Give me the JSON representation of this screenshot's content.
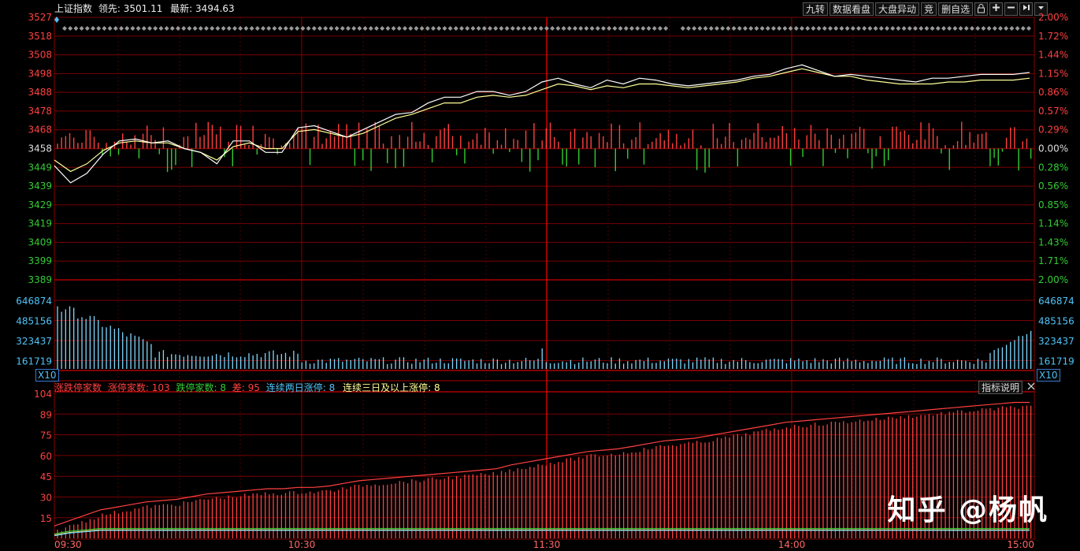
{
  "header": {
    "index_name": "上证指数",
    "leading_label": "领先:",
    "leading_value": "3501.11",
    "latest_label": "最新:",
    "latest_value": "3494.63"
  },
  "toolbar": {
    "items": [
      "九转",
      "数据看盘",
      "大盘异动",
      "竞",
      "删自选"
    ],
    "icons": [
      "lock-icon",
      "plus-icon",
      "minus-icon",
      "skip-right-icon",
      "dropdown-icon"
    ]
  },
  "price_axis": {
    "left_ticks": [
      "3527",
      "3518",
      "3508",
      "3498",
      "3488",
      "3478",
      "3468",
      "3458",
      "3449",
      "3439",
      "3429",
      "3419",
      "3409",
      "3399",
      "3389"
    ],
    "right_ticks_up": [
      "2.00%",
      "1.72%",
      "1.44%",
      "1.15%",
      "0.86%",
      "0.57%",
      "0.29%"
    ],
    "right_zero": "0.00%",
    "right_ticks_down": [
      "0.28%",
      "0.56%",
      "0.85%",
      "1.14%",
      "1.43%",
      "1.71%",
      "2.00%"
    ]
  },
  "volume_axis": {
    "ticks": [
      "646874",
      "485156",
      "323437",
      "161719"
    ],
    "multiplier": "X10"
  },
  "indicator": {
    "name": "涨跌停家数",
    "up_limit_label": "涨停家数:",
    "up_limit_value": "103",
    "down_limit_label": "跌停家数:",
    "down_limit_value": "8",
    "diff_label": "差:",
    "diff_value": "95",
    "two_day_label": "连续两日涨停:",
    "two_day_value": "8",
    "three_day_label": "连续三日及以上涨停:",
    "three_day_value": "8",
    "help_label": "指标说明",
    "ticks": [
      "104",
      "89",
      "75",
      "60",
      "45",
      "30",
      "15"
    ]
  },
  "time_axis": [
    "09:30",
    "10:30",
    "11:30",
    "14:00",
    "15:00"
  ],
  "watermark": "知乎 @杨帆",
  "colors": {
    "up": "#ff4040",
    "down": "#33cc33",
    "grid": "#7a0000",
    "price_line": "#ffffff",
    "avg_line": "#ffff99",
    "volume": "#7fd8ff",
    "cyan_text": "#4fc3f7"
  },
  "chart_data": [
    {
      "type": "line",
      "title": "上证指数",
      "y_range": [
        3389,
        3527
      ],
      "base": 3458,
      "series": [
        {
          "values": [
            3449,
            3440,
            3445,
            3455,
            3462,
            3463,
            3461,
            3462,
            3458,
            3456,
            3450,
            3462,
            3462,
            3456,
            3456,
            3469,
            3470,
            3467,
            3464,
            3468,
            3472,
            3476,
            3477,
            3482,
            3485,
            3485,
            3488,
            3488,
            3486,
            3488,
            3493,
            3495,
            3492,
            3490,
            3494,
            3492,
            3495,
            3494,
            3492,
            3491,
            3492,
            3493,
            3494,
            3496,
            3497,
            3500,
            3502,
            3499,
            3496,
            3497,
            3496,
            3495,
            3494,
            3493,
            3495,
            3495,
            3496,
            3497,
            3497,
            3497,
            3498
          ]
        },
        {
          "values": [
            3452,
            3446,
            3450,
            3457,
            3461,
            3462,
            3461,
            3461,
            3458,
            3456,
            3452,
            3459,
            3461,
            3458,
            3458,
            3467,
            3468,
            3466,
            3464,
            3466,
            3470,
            3474,
            3476,
            3479,
            3482,
            3482,
            3485,
            3486,
            3485,
            3486,
            3489,
            3492,
            3491,
            3489,
            3491,
            3490,
            3492,
            3492,
            3491,
            3490,
            3491,
            3492,
            3493,
            3495,
            3496,
            3498,
            3500,
            3498,
            3496,
            3496,
            3494,
            3493,
            3492,
            3492,
            3492,
            3493,
            3493,
            3494,
            3494,
            3494,
            3495
          ]
        }
      ]
    },
    {
      "type": "bar",
      "title": "涨跌停家数",
      "y_range": [
        0,
        111
      ],
      "series": [
        {
          "name": "涨停家数",
          "values": [
            10,
            14,
            18,
            22,
            24,
            26,
            28,
            29,
            30,
            32,
            34,
            35,
            36,
            37,
            38,
            38,
            39,
            39,
            40,
            42,
            44,
            45,
            46,
            47,
            48,
            49,
            50,
            51,
            52,
            53,
            56,
            58,
            60,
            62,
            64,
            66,
            67,
            68,
            70,
            72,
            74,
            75,
            76,
            78,
            80,
            82,
            84,
            86,
            88,
            89,
            90,
            91,
            92,
            93,
            94,
            95,
            96,
            97,
            98,
            99,
            100,
            101,
            102,
            103,
            103
          ]
        },
        {
          "name": "跌停家数",
          "values": [
            4,
            6,
            7,
            8,
            8,
            8,
            8,
            8,
            8,
            8,
            8,
            8,
            8,
            8,
            8,
            8,
            8,
            8,
            8,
            8,
            8,
            8,
            8,
            8,
            8,
            8,
            8,
            8,
            8,
            8,
            8,
            8,
            8,
            8,
            8,
            8,
            8,
            8,
            8,
            8,
            8,
            8,
            8,
            8,
            8,
            8,
            8,
            8,
            8,
            8,
            8,
            8,
            8,
            8,
            8,
            8,
            8,
            8,
            8,
            8,
            8,
            8,
            8,
            8,
            8
          ]
        }
      ]
    }
  ]
}
